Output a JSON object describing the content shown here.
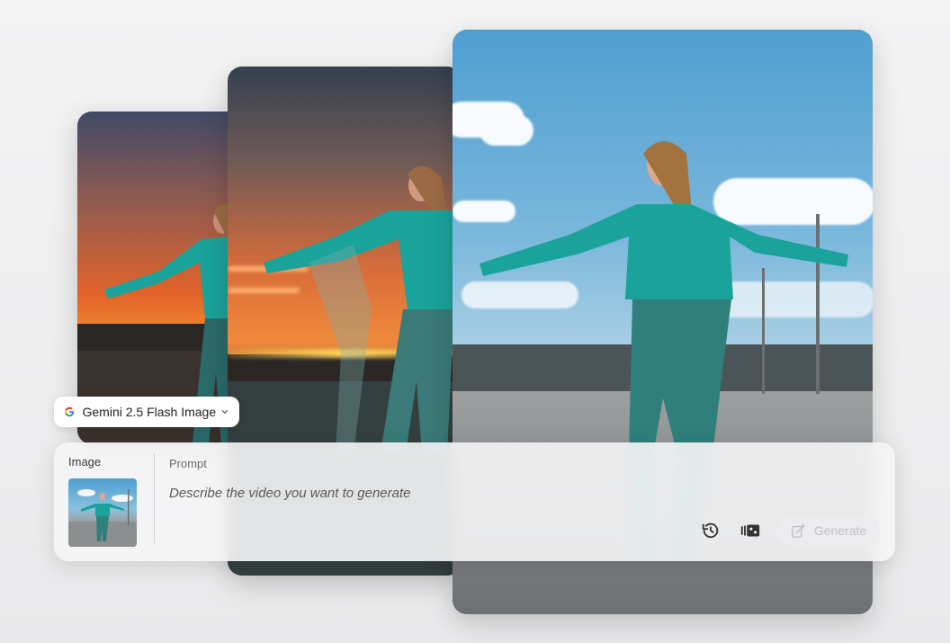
{
  "model_selector": {
    "label": "Gemini 2.5 Flash Image",
    "icon": "google-g-icon"
  },
  "prompt_panel": {
    "image_label": "Image",
    "prompt_label": "Prompt",
    "prompt_placeholder": "Describe the video you want to generate",
    "history_icon": "history-icon",
    "media_icon": "media-settings-icon",
    "generate_label": "Generate"
  },
  "colors": {
    "sky": "#4e9fd0",
    "jacket": "#1aa39a",
    "sunset": "#e2632a"
  }
}
